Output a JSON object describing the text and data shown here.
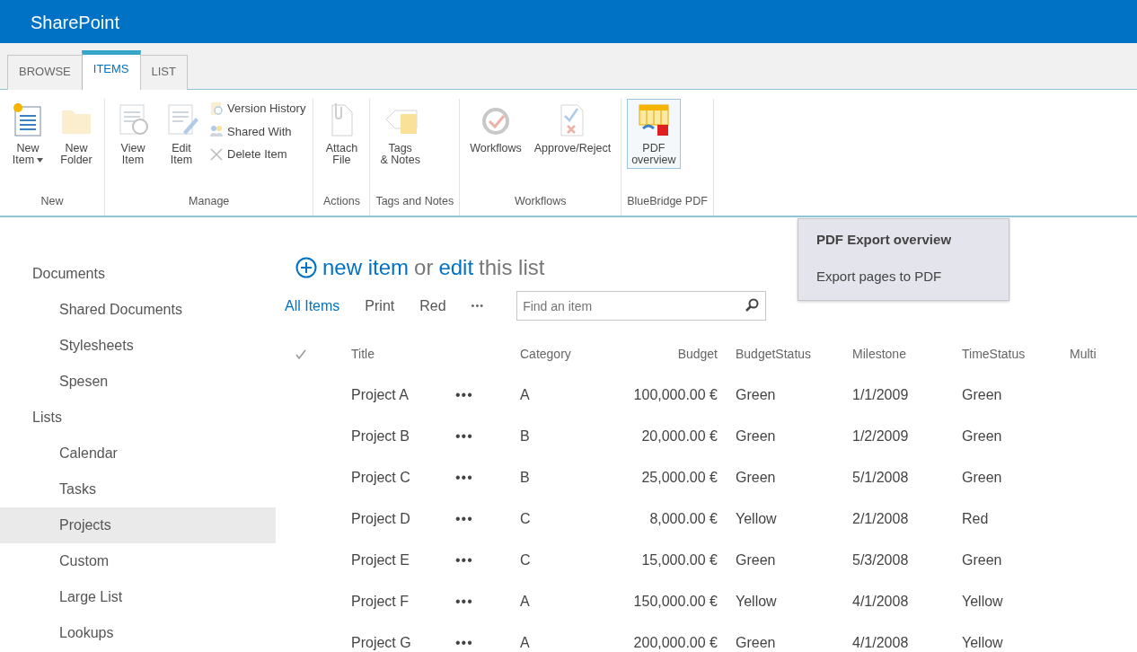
{
  "suite_bar": {
    "title": "SharePoint"
  },
  "tabs": [
    {
      "label": "BROWSE",
      "selected": false
    },
    {
      "label": "ITEMS",
      "selected": true
    },
    {
      "label": "LIST",
      "selected": false
    }
  ],
  "ribbon_groups": [
    {
      "label": "New",
      "buttons": [
        {
          "kind": "large",
          "label": "New Item",
          "dropdown": true,
          "disabled": false
        },
        {
          "kind": "large",
          "label": "New Folder",
          "disabled": true
        }
      ]
    },
    {
      "label": "Manage",
      "buttons": [
        {
          "kind": "large",
          "label": "View Item",
          "disabled": true
        },
        {
          "kind": "large",
          "label": "Edit Item",
          "disabled": true
        },
        {
          "kind": "stack",
          "items": [
            {
              "label": "Version History",
              "disabled": true
            },
            {
              "label": "Shared With",
              "disabled": true
            },
            {
              "label": "Delete Item",
              "disabled": true
            }
          ]
        }
      ]
    },
    {
      "label": "Actions",
      "buttons": [
        {
          "kind": "large",
          "label": "Attach File",
          "disabled": true
        }
      ]
    },
    {
      "label": "Tags and Notes",
      "buttons": [
        {
          "kind": "large",
          "label": "Tags & Notes",
          "disabled": true
        }
      ]
    },
    {
      "label": "Workflows",
      "buttons": [
        {
          "kind": "large",
          "label": "Workflows",
          "disabled": true
        },
        {
          "kind": "large",
          "label": "Approve/Reject",
          "disabled": true
        }
      ]
    },
    {
      "label": "BlueBridge PDF",
      "buttons": [
        {
          "kind": "large",
          "label": "PDF overview",
          "disabled": false,
          "selected": true
        }
      ]
    }
  ],
  "tooltip": {
    "title": "PDF Export overview",
    "description": "Export pages to PDF"
  },
  "sidebar": [
    {
      "label": "Documents",
      "children": [
        {
          "label": "Shared Documents",
          "selected": false
        },
        {
          "label": "Stylesheets",
          "selected": false
        },
        {
          "label": "Spesen",
          "selected": false
        }
      ]
    },
    {
      "label": "Lists",
      "children": [
        {
          "label": "Calendar",
          "selected": false
        },
        {
          "label": "Tasks",
          "selected": false
        },
        {
          "label": "Projects",
          "selected": true
        },
        {
          "label": "Custom",
          "selected": false
        },
        {
          "label": "Large List",
          "selected": false
        },
        {
          "label": "Lookups",
          "selected": false
        }
      ]
    }
  ],
  "heading": {
    "new_item": "new item",
    "or": "or",
    "edit": "edit",
    "rest": "this list"
  },
  "views": [
    {
      "label": "All Items",
      "selected": true
    },
    {
      "label": "Print",
      "selected": false
    },
    {
      "label": "Red",
      "selected": false
    }
  ],
  "more_views": "•••",
  "search": {
    "placeholder": "Find an item"
  },
  "table": {
    "columns": [
      "Title",
      "Category",
      "Budget",
      "BudgetStatus",
      "Milestone",
      "TimeStatus",
      "Multi"
    ],
    "rows": [
      {
        "title": "Project A",
        "menu": "•••",
        "category": "A",
        "budget": "100,000.00 €",
        "budget_status": "Green",
        "milestone": "1/1/2009",
        "time_status": "Green"
      },
      {
        "title": "Project B",
        "menu": "•••",
        "category": "B",
        "budget": "20,000.00 €",
        "budget_status": "Green",
        "milestone": "1/2/2009",
        "time_status": "Green"
      },
      {
        "title": "Project C",
        "menu": "•••",
        "category": "B",
        "budget": "25,000.00 €",
        "budget_status": "Green",
        "milestone": "5/1/2008",
        "time_status": "Green"
      },
      {
        "title": "Project D",
        "menu": "•••",
        "category": "C",
        "budget": "8,000.00 €",
        "budget_status": "Yellow",
        "milestone": "2/1/2008",
        "time_status": "Red"
      },
      {
        "title": "Project E",
        "menu": "•••",
        "category": "C",
        "budget": "15,000.00 €",
        "budget_status": "Green",
        "milestone": "5/3/2008",
        "time_status": "Green"
      },
      {
        "title": "Project F",
        "menu": "•••",
        "category": "A",
        "budget": "150,000.00 €",
        "budget_status": "Yellow",
        "milestone": "4/1/2008",
        "time_status": "Yellow"
      },
      {
        "title": "Project G",
        "menu": "•••",
        "category": "A",
        "budget": "200,000.00 €",
        "budget_status": "Green",
        "milestone": "4/1/2008",
        "time_status": "Yellow"
      }
    ]
  }
}
